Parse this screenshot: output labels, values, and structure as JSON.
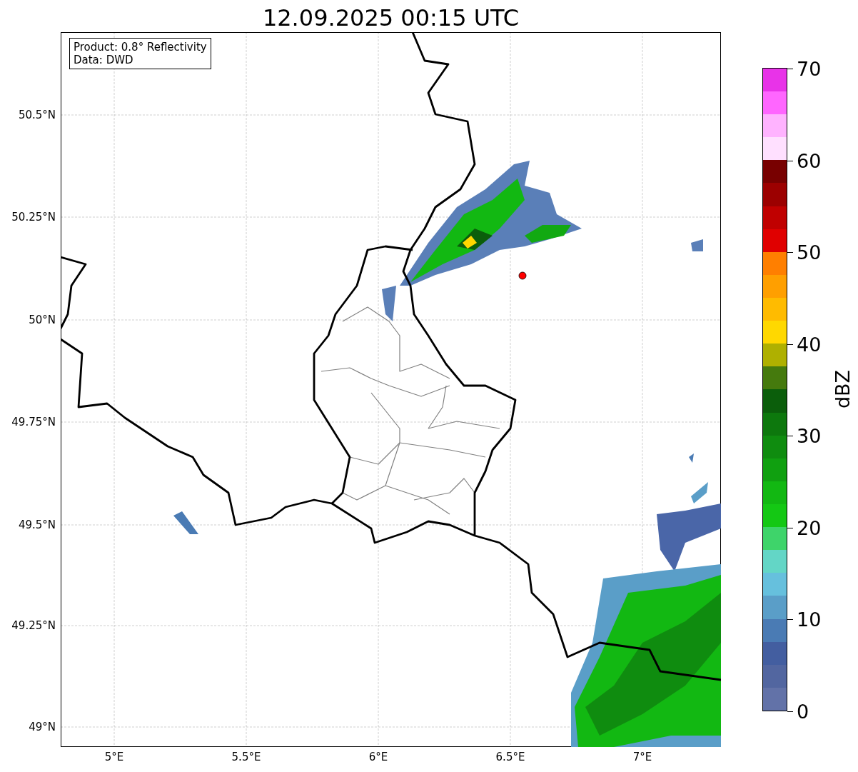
{
  "title": "12.09.2025 00:15 UTC",
  "info_box": {
    "lines": [
      "Product: 0.8° Reflectivity",
      "Data: DWD"
    ]
  },
  "map": {
    "lat_labels": [
      "50.5°N",
      "50.25°N",
      "50°N",
      "49.75°N",
      "49.5°N",
      "49.25°N",
      "49°N"
    ],
    "lon_labels": [
      "5°E",
      "5.5°E",
      "6°E",
      "6.5°E",
      "7°E"
    ]
  },
  "colorbar": {
    "label": "dBZ",
    "ticks": [
      "70",
      "60",
      "50",
      "40",
      "30",
      "20",
      "10",
      "0"
    ],
    "segments": [
      {
        "color": "#6272a8"
      },
      {
        "color": "#5266a0"
      },
      {
        "color": "#435ea0"
      },
      {
        "color": "#4a7bb4"
      },
      {
        "color": "#5a9ec8"
      },
      {
        "color": "#66c0dd"
      },
      {
        "color": "#63d6c6"
      },
      {
        "color": "#3ed46a"
      },
      {
        "color": "#14c814"
      },
      {
        "color": "#12b812"
      },
      {
        "color": "#10a010"
      },
      {
        "color": "#0f8c0f"
      },
      {
        "color": "#0d780d"
      },
      {
        "color": "#0b5e0b"
      },
      {
        "color": "#457a0d"
      },
      {
        "color": "#afb000"
      },
      {
        "color": "#ffd800"
      },
      {
        "color": "#ffbb00"
      },
      {
        "color": "#ff9f00"
      },
      {
        "color": "#ff7f00"
      },
      {
        "color": "#e00000"
      },
      {
        "color": "#c00000"
      },
      {
        "color": "#9c0000"
      },
      {
        "color": "#780000"
      },
      {
        "color": "#ffe0ff"
      },
      {
        "color": "#ffb3ff"
      },
      {
        "color": "#ff66ff"
      },
      {
        "color": "#e833e8"
      }
    ]
  }
}
